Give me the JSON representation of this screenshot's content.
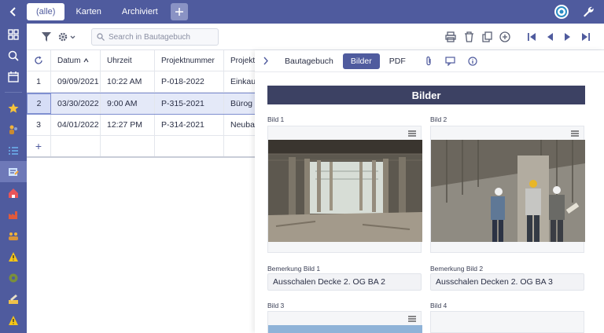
{
  "tabs": [
    {
      "label": "(alle)",
      "active": true
    },
    {
      "label": "Karten"
    },
    {
      "label": "Archiviert"
    }
  ],
  "search": {
    "placeholder": "Search in Bautagebuch"
  },
  "grid": {
    "columns": [
      "Datum",
      "Uhrzeit",
      "Projektnummer",
      "Projekti"
    ],
    "rows": [
      {
        "num": "1",
        "datum": "09/09/2021",
        "uhrzeit": "10:22 AM",
        "projekt": "P-018-2022",
        "extra": "Einkauf"
      },
      {
        "num": "2",
        "datum": "03/30/2022",
        "uhrzeit": "9:00 AM",
        "projekt": "P-315-2021",
        "extra": "Bürog"
      },
      {
        "num": "3",
        "datum": "04/01/2022",
        "uhrzeit": "12:27 PM",
        "projekt": "P-314-2021",
        "extra": "Neubau"
      }
    ],
    "add": "+"
  },
  "panel": {
    "tabs": [
      "Bautagebuch",
      "Bilder",
      "PDF"
    ],
    "section_title": "Bilder",
    "fields": {
      "bild1": "Bild 1",
      "bild2": "Bild 2",
      "bild3": "Bild 3",
      "bild4": "Bild 4",
      "bemerkung1_label": "Bemerkung Bild 1",
      "bemerkung1_value": "Ausschalen Decke 2. OG BA 2",
      "bemerkung2_label": "Bemerkung Bild 2",
      "bemerkung2_value": "Ausschalen Decken 2. OG BA 3"
    }
  },
  "colors": {
    "accent": "#4f5b9e",
    "dark": "#3c4163"
  }
}
